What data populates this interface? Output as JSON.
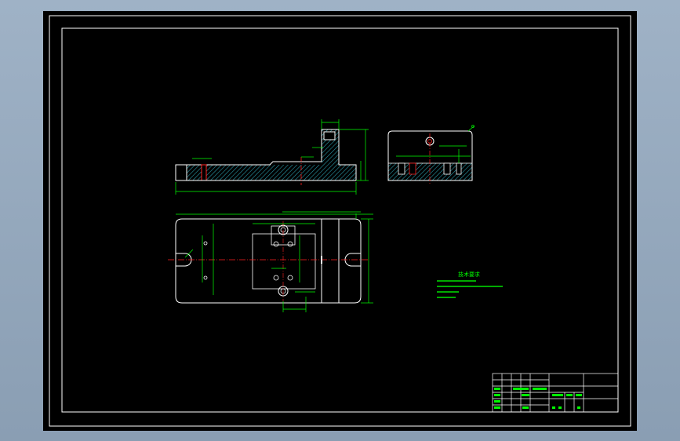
{
  "colors": {
    "background_outer": "#9aadc2",
    "paper": "#000000",
    "frame": "#ffffff",
    "part": "#ffffff",
    "hatch": "#2a9aa8",
    "dimension": "#00ff00",
    "centerline": "#ff2020",
    "note_text": "#00ff00"
  },
  "title_block": {
    "cells": [
      "",
      "",
      "",
      "",
      "",
      "",
      "",
      "",
      ""
    ]
  },
  "notes": {
    "heading": "技术要求",
    "lines": [
      "",
      "",
      "",
      ""
    ]
  }
}
